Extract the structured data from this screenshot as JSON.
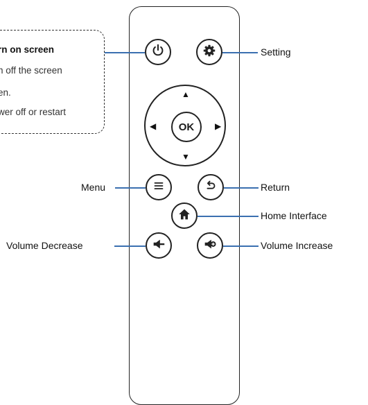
{
  "callout": {
    "lines": [
      "rn on screen",
      "n off the screen",
      "en.",
      "wer off or restart"
    ]
  },
  "buttons": {
    "power": {
      "icon": "power-icon"
    },
    "settings": {
      "icon": "gear-icon"
    },
    "ok": {
      "label": "OK"
    },
    "menu": {
      "icon": "menu-icon"
    },
    "return": {
      "icon": "return-icon"
    },
    "home": {
      "icon": "home-icon"
    },
    "volume_decrease": {
      "icon": "speaker-minus-icon"
    },
    "volume_increase": {
      "icon": "speaker-plus-icon"
    }
  },
  "labels": {
    "setting": "Setting",
    "menu": "Menu",
    "return": "Return",
    "home_interface": "Home Interface",
    "volume_decrease": "Volume Decrease",
    "volume_increase": "Volume Increase"
  },
  "colors": {
    "outline": "#222222",
    "connector": "#3a6fb0"
  }
}
